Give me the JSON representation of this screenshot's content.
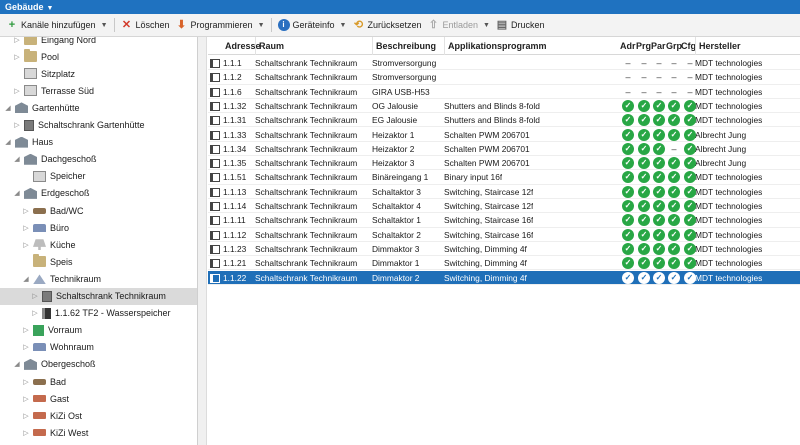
{
  "title": "Gebäude",
  "toolbar": {
    "add_channels": "Kanäle hinzufügen",
    "delete": "Löschen",
    "program": "Programmieren",
    "device_info": "Geräteinfo",
    "reset": "Zurücksetzen",
    "unload": "Entladen",
    "print": "Drucken"
  },
  "tree": [
    {
      "label": "Eingang Nord",
      "depth": 1,
      "icon": "folder-icon",
      "exp": "▷"
    },
    {
      "label": "Pool",
      "depth": 1,
      "icon": "folder-icon",
      "exp": "▷"
    },
    {
      "label": "Sitzplatz",
      "depth": 1,
      "icon": "room-icon",
      "exp": ""
    },
    {
      "label": "Terrasse Süd",
      "depth": 1,
      "icon": "room-icon",
      "exp": "▷"
    },
    {
      "label": "Gartenhütte",
      "depth": 0,
      "icon": "building-icon",
      "exp": "◢"
    },
    {
      "label": "Schaltschrank Gartenhütte",
      "depth": 1,
      "icon": "cabinet-icon",
      "exp": "▷"
    },
    {
      "label": "Haus",
      "depth": 0,
      "icon": "building-icon",
      "exp": "◢"
    },
    {
      "label": "Dachgeschoß",
      "depth": 1,
      "icon": "building-icon",
      "exp": "◢"
    },
    {
      "label": "Speicher",
      "depth": 2,
      "icon": "room-icon",
      "exp": ""
    },
    {
      "label": "Erdgeschoß",
      "depth": 1,
      "icon": "building-icon",
      "exp": "◢"
    },
    {
      "label": "Bad/WC",
      "depth": 2,
      "icon": "tool-icon",
      "exp": "▷"
    },
    {
      "label": "Büro",
      "depth": 2,
      "icon": "sofa-icon",
      "exp": "▷"
    },
    {
      "label": "Küche",
      "depth": 2,
      "icon": "lamp-icon",
      "exp": "▷"
    },
    {
      "label": "Speis",
      "depth": 2,
      "icon": "folder-icon",
      "exp": ""
    },
    {
      "label": "Technikraum",
      "depth": 2,
      "icon": "tech-icon",
      "exp": "◢"
    },
    {
      "label": "Schaltschrank Technikraum",
      "depth": 3,
      "icon": "cabinet-icon",
      "exp": "▷",
      "selected": true
    },
    {
      "label": "1.1.62 TF2 - Wasserspeicher",
      "depth": 3,
      "icon": "device-icon",
      "exp": "▷"
    },
    {
      "label": "Vorraum",
      "depth": 2,
      "icon": "green-icon",
      "exp": "▷"
    },
    {
      "label": "Wohnraum",
      "depth": 2,
      "icon": "sofa-icon",
      "exp": "▷"
    },
    {
      "label": "Obergeschoß",
      "depth": 1,
      "icon": "building-icon",
      "exp": "◢"
    },
    {
      "label": "Bad",
      "depth": 2,
      "icon": "tool-icon",
      "exp": "▷"
    },
    {
      "label": "Gast",
      "depth": 2,
      "icon": "bed-icon",
      "exp": "▷"
    },
    {
      "label": "KiZi Ost",
      "depth": 2,
      "icon": "bed-icon",
      "exp": "▷"
    },
    {
      "label": "KiZi West",
      "depth": 2,
      "icon": "bed-icon",
      "exp": "▷"
    },
    {
      "label": "Schlafzimmer",
      "depth": 2,
      "icon": "bed-icon",
      "exp": "▷"
    }
  ],
  "columns": [
    "Adresse",
    "Raum",
    "Beschreibung",
    "Applikationsprogramm",
    "Adr",
    "Prg",
    "Par",
    "Grp",
    "Cfg",
    "Hersteller"
  ],
  "rows": [
    {
      "addr": "1.1.1",
      "room": "Schaltschrank Technikraum",
      "desc": "Stromversorgung",
      "app": "",
      "status": [
        "-",
        "-",
        "-",
        "-",
        "-"
      ],
      "maker": "MDT technologies"
    },
    {
      "addr": "1.1.2",
      "room": "Schaltschrank Technikraum",
      "desc": "Stromversorgung",
      "app": "",
      "status": [
        "-",
        "-",
        "-",
        "-",
        "-"
      ],
      "maker": "MDT technologies"
    },
    {
      "addr": "1.1.6",
      "room": "Schaltschrank Technikraum",
      "desc": "GIRA USB-H53",
      "app": "",
      "status": [
        "-",
        "-",
        "-",
        "-",
        "-"
      ],
      "maker": "MDT technologies"
    },
    {
      "addr": "1.1.32",
      "room": "Schaltschrank Technikraum",
      "desc": "OG Jalousie",
      "app": "Shutters and Blinds 8-fold",
      "status": [
        "ok",
        "ok",
        "ok",
        "ok",
        "ok"
      ],
      "maker": "MDT technologies"
    },
    {
      "addr": "1.1.31",
      "room": "Schaltschrank Technikraum",
      "desc": "EG Jalousie",
      "app": "Shutters and Blinds 8-fold",
      "status": [
        "ok",
        "ok",
        "ok",
        "ok",
        "ok"
      ],
      "maker": "MDT technologies"
    },
    {
      "addr": "1.1.33",
      "room": "Schaltschrank Technikraum",
      "desc": "Heizaktor 1",
      "app": "Schalten PWM 206701",
      "status": [
        "ok",
        "ok",
        "ok",
        "ok",
        "ok"
      ],
      "maker": "Albrecht Jung"
    },
    {
      "addr": "1.1.34",
      "room": "Schaltschrank Technikraum",
      "desc": "Heizaktor 2",
      "app": "Schalten PWM 206701",
      "status": [
        "ok",
        "ok",
        "ok",
        "-",
        "ok"
      ],
      "maker": "Albrecht Jung"
    },
    {
      "addr": "1.1.35",
      "room": "Schaltschrank Technikraum",
      "desc": "Heizaktor 3",
      "app": "Schalten PWM 206701",
      "status": [
        "ok",
        "ok",
        "ok",
        "ok",
        "ok"
      ],
      "maker": "Albrecht Jung"
    },
    {
      "addr": "1.1.51",
      "room": "Schaltschrank Technikraum",
      "desc": "Binäreingang 1",
      "app": "Binary input 16f",
      "status": [
        "ok",
        "ok",
        "ok",
        "ok",
        "ok"
      ],
      "maker": "MDT technologies"
    },
    {
      "addr": "1.1.13",
      "room": "Schaltschrank Technikraum",
      "desc": "Schaltaktor 3",
      "app": "Switching, Staircase 12f",
      "status": [
        "ok",
        "ok",
        "ok",
        "ok",
        "ok"
      ],
      "maker": "MDT technologies"
    },
    {
      "addr": "1.1.14",
      "room": "Schaltschrank Technikraum",
      "desc": "Schaltaktor 4",
      "app": "Switching, Staircase 12f",
      "status": [
        "ok",
        "ok",
        "ok",
        "ok",
        "ok"
      ],
      "maker": "MDT technologies"
    },
    {
      "addr": "1.1.11",
      "room": "Schaltschrank Technikraum",
      "desc": "Schaltaktor 1",
      "app": "Switching, Staircase 16f",
      "status": [
        "ok",
        "ok",
        "ok",
        "ok",
        "ok"
      ],
      "maker": "MDT technologies"
    },
    {
      "addr": "1.1.12",
      "room": "Schaltschrank Technikraum",
      "desc": "Schaltaktor 2",
      "app": "Switching, Staircase 16f",
      "status": [
        "ok",
        "ok",
        "ok",
        "ok",
        "ok"
      ],
      "maker": "MDT technologies"
    },
    {
      "addr": "1.1.23",
      "room": "Schaltschrank Technikraum",
      "desc": "Dimmaktor 3",
      "app": "Switching, Dimming 4f",
      "status": [
        "ok",
        "ok",
        "ok",
        "ok",
        "ok"
      ],
      "maker": "MDT technologies"
    },
    {
      "addr": "1.1.21",
      "room": "Schaltschrank Technikraum",
      "desc": "Dimmaktor 1",
      "app": "Switching, Dimming 4f",
      "status": [
        "ok",
        "ok",
        "ok",
        "ok",
        "ok"
      ],
      "maker": "MDT technologies"
    },
    {
      "addr": "1.1.22",
      "room": "Schaltschrank Technikraum",
      "desc": "Dimmaktor 2",
      "app": "Switching, Dimming 4f",
      "status": [
        "ok",
        "ok",
        "ok",
        "ok",
        "ok"
      ],
      "maker": "MDT technologies",
      "selected": true
    }
  ],
  "colors": {
    "accent": "#1f72c0",
    "selection": "#1f6fb8",
    "ok": "#28a745"
  }
}
